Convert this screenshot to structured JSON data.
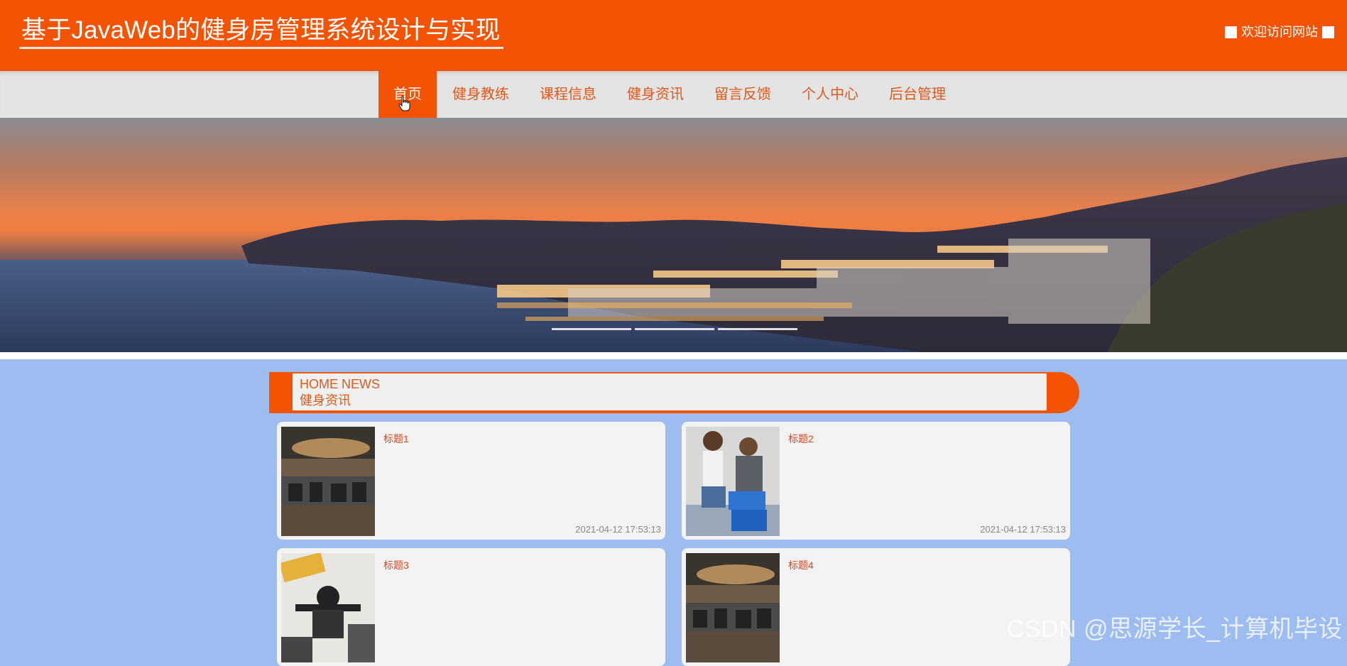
{
  "header": {
    "title": "基于JavaWeb的健身房管理系统设计与实现",
    "welcome": "欢迎访问网站",
    "brand_color": "#f55304"
  },
  "nav": {
    "items": [
      {
        "label": "首页",
        "active": true
      },
      {
        "label": "健身教练"
      },
      {
        "label": "课程信息"
      },
      {
        "label": "健身资讯"
      },
      {
        "label": "留言反馈"
      },
      {
        "label": "个人中心"
      },
      {
        "label": "后台管理"
      }
    ]
  },
  "banner": {
    "slide_count": 3
  },
  "news": {
    "heading_en": "HOME NEWS",
    "heading_cn": "健身资讯",
    "items": [
      {
        "title": "标题1",
        "time": "2021-04-12 17:53:13",
        "thumb": "gym-interior"
      },
      {
        "title": "标题2",
        "time": "2021-04-12 17:53:13",
        "thumb": "trainer-and-client"
      },
      {
        "title": "标题3",
        "title_color": "#e0441a",
        "thumb": "personal-trainer-poster"
      },
      {
        "title": "标题4",
        "thumb": "gym-interior"
      }
    ]
  },
  "watermark": "CSDN @思源学长_计算机毕设"
}
